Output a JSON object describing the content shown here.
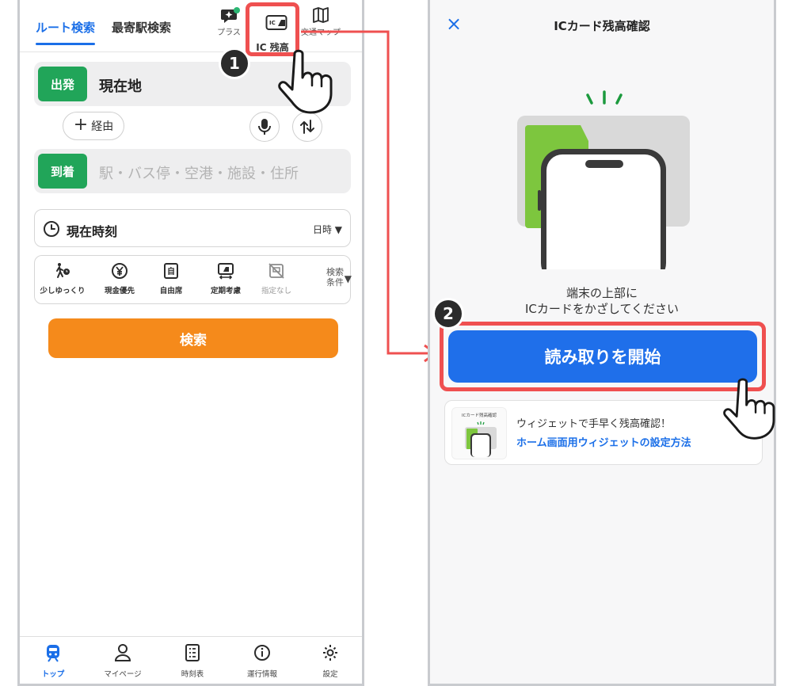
{
  "left": {
    "tabs": [
      {
        "label": "ルート検索",
        "active": true
      },
      {
        "label": "最寄駅検索",
        "active": false
      }
    ],
    "top_icons": {
      "plus": "プラス",
      "ic_balance": "IC 残高",
      "map": "交通マップ"
    },
    "departure": {
      "tag": "出発",
      "value": "現在地"
    },
    "via_label": "経由",
    "arrival": {
      "tag": "到着",
      "placeholder": "駅・バス停・空港・施設・住所"
    },
    "time": {
      "label": "現在時刻",
      "mode": "日時 ▼"
    },
    "options": [
      {
        "icon": "walk-slow-icon",
        "label": "少しゆっくり"
      },
      {
        "icon": "yen-icon",
        "label": "現金優先"
      },
      {
        "icon": "seat-icon",
        "label": "自由席"
      },
      {
        "icon": "commuter-pass-icon",
        "label": "定期考慮"
      },
      {
        "icon": "no-preference-icon",
        "label": "指定なし"
      }
    ],
    "more_conditions": [
      "検索",
      "条件"
    ],
    "search_button": "検索",
    "bottom_nav": [
      {
        "label": "トップ",
        "active": true
      },
      {
        "label": "マイページ",
        "active": false
      },
      {
        "label": "時刻表",
        "active": false
      },
      {
        "label": "運行情報",
        "active": false
      },
      {
        "label": "設定",
        "active": false
      }
    ],
    "step_badge": "1"
  },
  "right": {
    "close_icon": "×",
    "title": "ICカード残高確認",
    "instruction_line1": "端末の上部に",
    "instruction_line2": "ICカードをかざしてください",
    "start_button": "読み取りを開始",
    "step_badge": "2",
    "widget": {
      "thumb_title": "ICカード残高確認",
      "text": "ウィジェットで手早く残高確認！",
      "link": "ホーム画面用ウィジェットの設定方法"
    }
  },
  "colors": {
    "accent_blue": "#1b6fe8",
    "green_tag": "#21a559",
    "search_orange": "#f58a1b",
    "highlight_red": "#ef5050",
    "card_green": "#7dc63e"
  }
}
